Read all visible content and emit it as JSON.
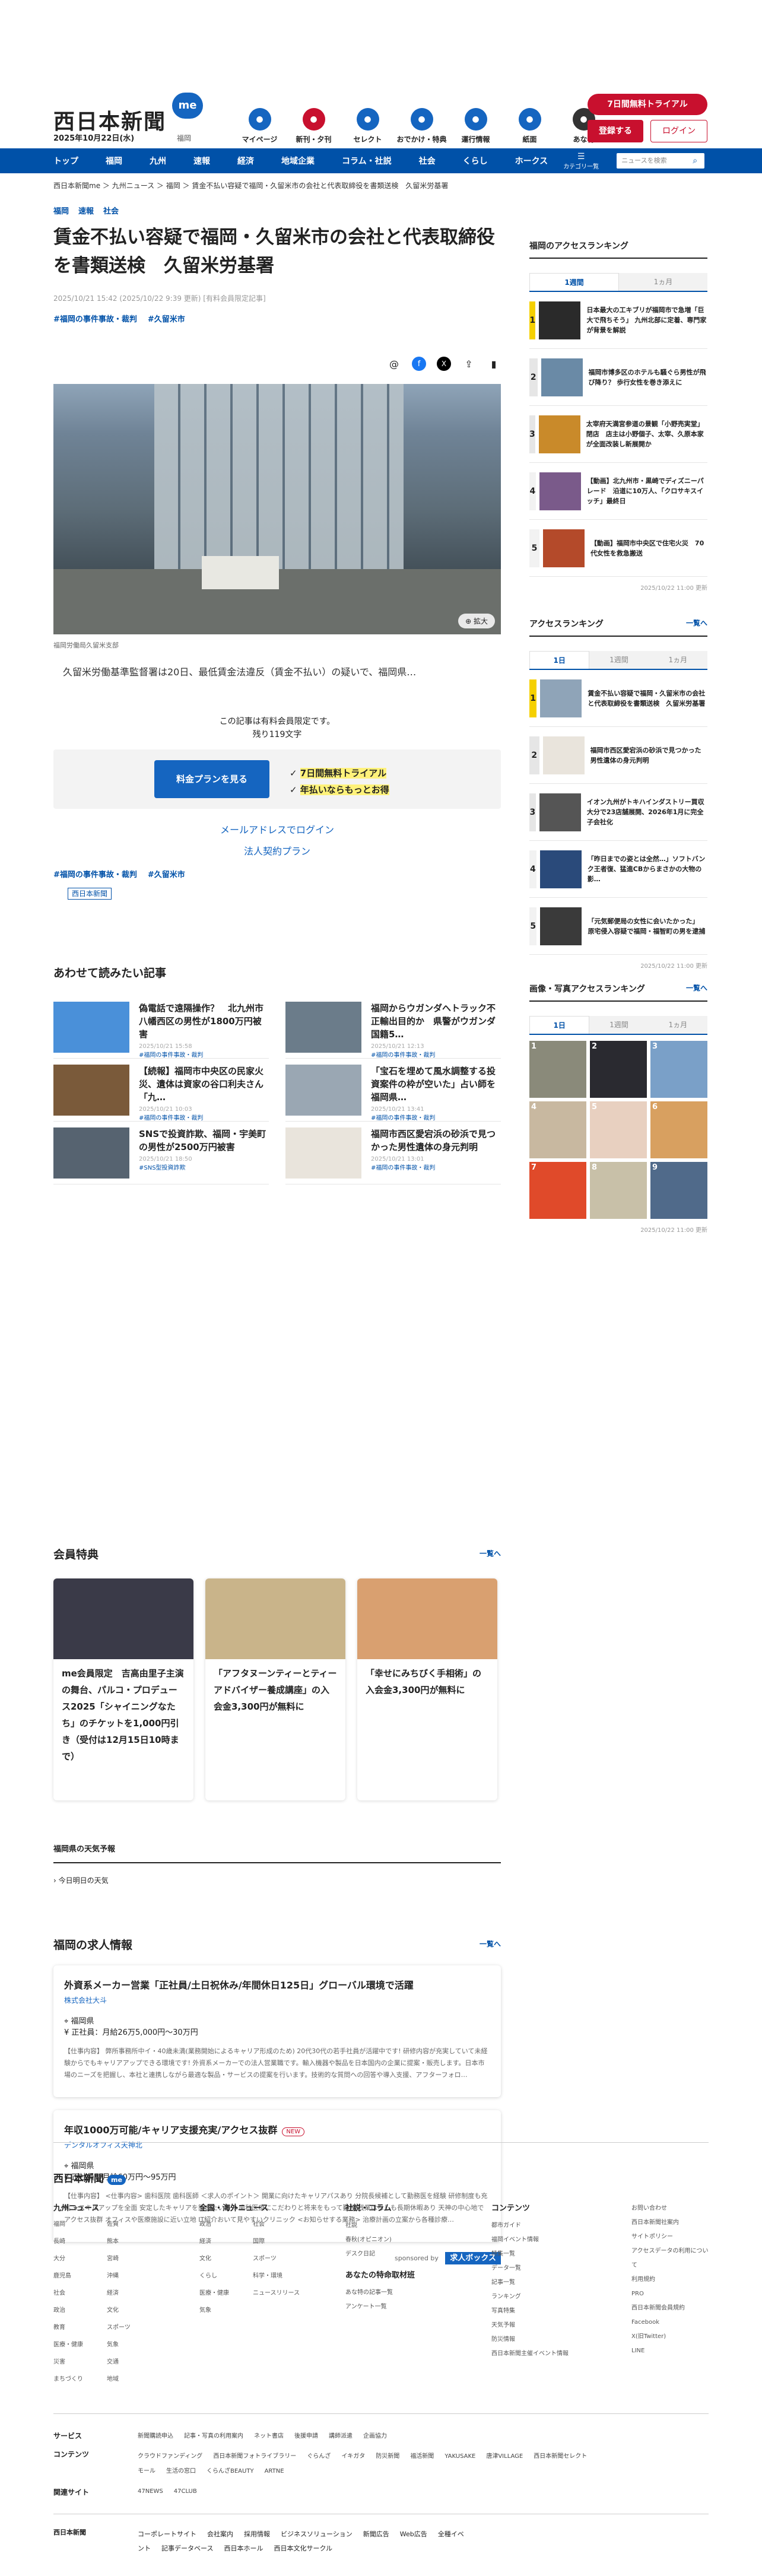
{
  "header": {
    "logo": "西日本新聞",
    "logo_badge": "me",
    "date": "2025年10月22日(水)",
    "area": "福岡",
    "nav": [
      {
        "label": "マイページ",
        "icon": "me-icon",
        "color": "#1565c0"
      },
      {
        "label": "新刊・夕刊",
        "icon": "newspaper-icon",
        "color": "#c8102e"
      },
      {
        "label": "セレクト",
        "icon": "select-icon",
        "color": "#1565c0"
      },
      {
        "label": "おでかけ・特典",
        "icon": "walk-icon",
        "color": "#1565c0"
      },
      {
        "label": "運行情報",
        "icon": "train-icon",
        "color": "#1565c0"
      },
      {
        "label": "紙面",
        "icon": "paper-icon",
        "color": "#1565c0"
      },
      {
        "label": "あな特",
        "icon": "anatoku-icon",
        "color": "#333333"
      }
    ],
    "trial": "7日間無料トライアル",
    "register": "登録する",
    "login": "ログイン"
  },
  "gnav": {
    "items": [
      "トップ",
      "福岡",
      "九州",
      "速報",
      "経済",
      "地域企業",
      "コラム・社説",
      "社会",
      "くらし",
      "ホークス"
    ],
    "category": "カテゴリ一覧",
    "search_placeholder": "ニュースを検索"
  },
  "breadcrumb": "西日本新聞me ＞ 九州ニュース ＞ 福岡 ＞ 賃金不払い容疑で福岡・久留米市の会社と代表取締役を書類送検　久留米労基署",
  "article": {
    "tags": [
      "福岡",
      "速報",
      "社会"
    ],
    "title": "賃金不払い容疑で福岡・久留米市の会社と代表取締役を書類送検　久留米労基署",
    "meta": "2025/10/21 15:42 (2025/10/22 9:39 更新) [有料会員限定記事]",
    "hashtags": [
      "#福岡の事件事故・裁判",
      "#久留米市"
    ],
    "photo_caption": "福岡労働局久留米支部",
    "zoom": "拡大",
    "lead": "久留米労働基準監督署は20日、最低賃金法違反（賃金不払い）の疑いで、福岡県…",
    "paywall1": "この記事は有料会員限定です。",
    "paywall2": "残り119文字",
    "plan_button": "料金プランを見る",
    "note1": "7日間無料トライアル",
    "note2": "年払いならもっとお得",
    "email_login": "メールアドレスでログイン",
    "corp_plan": "法人契約プラン",
    "publisher": "西日本新聞"
  },
  "related": {
    "title": "あわせて読みたい記事",
    "items": [
      {
        "title": "偽電話で遠隔操作？　北九州市八幡西区の男性が1800万円被害",
        "date": "2025/10/21 15:58",
        "tag": "#福岡の事件事故・裁判",
        "color": "#4a90d9"
      },
      {
        "title": "福岡からウガンダへトラック不正輸出目的か　県警がウガンダ国籍5…",
        "date": "2025/10/21 12:13",
        "tag": "#福岡の事件事故・裁判",
        "color": "#6b7c8a"
      },
      {
        "title": "【続報】福岡市中央区の民家火災、遺体は資家の谷口利夫さん「九…",
        "date": "2025/10/21 10:03",
        "tag": "#福岡の事件事故・裁判",
        "color": "#7a5a3a"
      },
      {
        "title": "「宝石を埋めて風水調整する投資案件の枠が空いた」占い師を福岡県…",
        "date": "2025/10/21 13:41",
        "tag": "#福岡の事件事故・裁判",
        "color": "#9aa7b3"
      },
      {
        "title": "SNSで投資詐欺、福岡・宇美町の男性が2500万円被害",
        "date": "2025/10/21 18:50",
        "tag": "#SNS型投資詐欺",
        "color": "#566370"
      },
      {
        "title": "福岡市西区愛宕浜の砂浜で見つかった男性遺体の身元判明",
        "date": "2025/10/21 13:01",
        "tag": "#福岡の事件事故・裁判",
        "color": "#e9e4dc"
      }
    ]
  },
  "perks": {
    "title": "会員特典",
    "more": "一覧へ",
    "items": [
      {
        "title": "me会員限定　吉高由里子主演の舞台、パルコ・プロデュース2025「シャイニングなたち」のチケットを1,000円引き（受付は12月15日10時まで）",
        "color": "#3a3a48"
      },
      {
        "title": "「アフタヌーンティーとティーアドバイザー養成講座」の入会金3,300円が無料に",
        "color": "#c9b48a"
      },
      {
        "title": "「幸せにみちびく手相術」の入会金3,300円が無料に",
        "color": "#d9a070"
      }
    ]
  },
  "weather": {
    "title": "福岡県の天気予報",
    "link": "今日明日の天気"
  },
  "jobs": {
    "title": "福岡の求人情報",
    "more": "一覧へ",
    "items": [
      {
        "title": "外資系メーカー営業「正社員/土日祝休み/年間休日125日」グローバル環境で活躍",
        "company": "株式会社大斗",
        "area": "福岡県",
        "salary": "正社員：月給26万5,000円〜30万円",
        "desc": "【仕事内容】 弊所事務所中イ・40歳未満(業務開始によるキャリア形成のため) 20代30代の若手社員が活躍中です! 研修内容が充実していて未経験からでもキャリアアップできる環境です! 外資系メーカーでの法人営業職です。輸入機器や製品を日本国内の企業に提案・販売します。日本市場のニーズを把握し、本社と連携しながら最適な製品・サービスの提案を行います。技術的な質問への回答や導入支援、アフターフォロ…",
        "badge": ""
      },
      {
        "title": "年収1000万可能/キャリア支援充実/アクセス抜群",
        "company": "デンタルオフィス天神北",
        "area": "福岡県",
        "salary": "正社員：月給60万円〜95万円",
        "desc": "【仕事内容】 <仕事内容> 歯科医院 歯科医師 ＜求人のポイント＞ 開業に向けたキャリアパスあり 分院長候補として勤務医を経験 研修制度も充実 ★スキルアップを全面 安定したキャリアを築きたい方 ★歯科医療にこだわりと将来をもって勤務 残業はなしも長期休暇あり 天神の中心地でアクセス抜群 オフィスや医療施設に近い立地 IT紹介おいて見やすいクリニック <お知らせする業務> 治療計画の立案から各種診療…",
        "badge": "NEW"
      }
    ],
    "sponsored": "sponsored by",
    "sponsor_name": "求人ボックス"
  },
  "side": {
    "access": {
      "title": "福岡のアクセスランキング",
      "tabs": [
        "1週間",
        "1ヵ月"
      ],
      "items": [
        {
          "no": "1",
          "title": "日本最大の工キブリが福岡市で急増「巨大で飛ちそう」 九州北部に定着、専門家が背景を解説",
          "color": "#2a2a2a"
        },
        {
          "no": "2",
          "title": "福岡市博多区のホテルも騒ぐら男性が飛び降り？ 歩行女性を巻き添えに",
          "color": "#6a8aa6"
        },
        {
          "no": "3",
          "title": "太宰府天満宮参道の景観「小野売実堂」閉店　店主は小野個子、太宰、久原本家が全面改装し新展開か",
          "color": "#c98a2a"
        },
        {
          "no": "4",
          "title": "【動画】北九州市・黒崎でディズニーパレード　沿道に10万人、「クロサキスイッチ」最終日",
          "color": "#7a5a8a"
        },
        {
          "no": "5",
          "title": "【動画】福岡市中央区で住宅火災　70代女性を救急搬送",
          "color": "#b44a2a"
        }
      ],
      "updated": "2025/10/22 11:00 更新"
    },
    "all": {
      "title": "アクセスランキング",
      "more": "一覧へ",
      "tabs": [
        "1日",
        "1週間",
        "1ヵ月"
      ],
      "items": [
        {
          "no": "1",
          "title": "賃金不払い容疑で福岡・久留米市の会社と代表取締役を書類送検　久留米労基署",
          "color": "#8fa4b8"
        },
        {
          "no": "2",
          "title": "福岡市西区愛宕浜の砂浜で見つかった男性遺体の身元判明",
          "color": "#e9e4dc"
        },
        {
          "no": "3",
          "title": "イオン九州がトキハインダストリー買収　大分で23店舗展開、2026年1月に完全子会社化",
          "color": "#555555"
        },
        {
          "no": "4",
          "title": "「昨日までの姿とは全然…」ソフトバンク王者復、猛進CBからまさかの大物の影…",
          "color": "#2a4a7a"
        },
        {
          "no": "5",
          "title": "「元気郵便局の女性に会いたかった」 原宅侵入容疑で福岡・福智町の男を逮捕",
          "color": "#3a3a3a"
        }
      ],
      "updated": "2025/10/22 11:00 更新"
    },
    "images": {
      "title": "画像・写真アクセスランキング",
      "more": "一覧へ",
      "tabs": [
        "1日",
        "1週間",
        "1ヵ月"
      ],
      "items": [
        {
          "no": "1",
          "color": "#8a8a7a"
        },
        {
          "no": "2",
          "color": "#2a2a30"
        },
        {
          "no": "3",
          "color": "#7aa0c8"
        },
        {
          "no": "4",
          "color": "#c8b8a0"
        },
        {
          "no": "5",
          "color": "#e8d0c0"
        },
        {
          "no": "6",
          "color": "#d8a060"
        },
        {
          "no": "7",
          "color": "#e04a2a"
        },
        {
          "no": "8",
          "color": "#c8c0a8"
        },
        {
          "no": "9",
          "color": "#506a8a"
        }
      ],
      "updated": "2025/10/22 11:00 更新"
    }
  },
  "footer": {
    "logo": "西日本新聞",
    "logo_badge": "me",
    "cols": [
      {
        "title": "九州ニュース",
        "items": [
          "福岡",
          "佐賀",
          "長崎",
          "熊本",
          "大分",
          "宮崎",
          "鹿児島",
          "沖縄",
          "社会",
          "経済",
          "政治",
          "文化",
          "教育",
          "スポーツ",
          "医療・健康",
          "気象",
          "災害",
          "交通",
          "まちづくり",
          "地域"
        ]
      },
      {
        "title": "全国・海外ニュース",
        "items": [
          "政治",
          "社会",
          "経済",
          "国際",
          "文化",
          "スポーツ",
          "くらし",
          "科学・環境",
          "医療・健康",
          "ニュースリリース",
          "気象"
        ]
      },
      {
        "title": "社説・コラム",
        "items": [
          "社説",
          "春秋(オピニオン)",
          "デスク日記"
        ]
      }
    ],
    "col3_sub": "あなたの特命取材班",
    "col3_sub_items": [
      "あな特の記事一覧",
      "アンケート一覧"
    ],
    "contents_title": "コンテンツ",
    "contents": [
      "都市ガイド",
      "福岡イベント情報",
      "特集一覧",
      "データ一覧",
      "記事一覧",
      "ランキング",
      "写真特集",
      "天気予報",
      "防災情報",
      "西日本新聞主催イベント情報"
    ],
    "links": [
      "お問い合わせ",
      "西日本新聞社案内",
      "サイトポリシー",
      "アクセスデータの利用について",
      "利用規約",
      "PRO",
      "西日本新聞会員規約",
      "Facebook",
      "X(旧Twitter)",
      "LINE"
    ],
    "service_label": "サービス",
    "service": [
      "新聞購読申込",
      "記事・写真の利用案内",
      "ネット書店",
      "後援申請",
      "講師派遣",
      "企画協力"
    ],
    "contents2_label": "コンテンツ",
    "contents2": [
      "クラウドファンディング",
      "西日本新聞フォトライブラリー",
      "ぐらんざ",
      "イキガタ",
      "防災新聞",
      "福活新聞",
      "YAKUSAKE",
      "唐津VILLAGE",
      "西日本新聞セレクトモール",
      "生活の窓口",
      "くらんざBEAUTY",
      "ARTNE"
    ],
    "related_label": "関連サイト",
    "related": [
      "47NEWS",
      "47CLUB"
    ],
    "bottom_logo": "西日本新聞",
    "bottom": [
      "コーポレートサイト",
      "会社案内",
      "採用情報",
      "ビジネスソリューション",
      "新聞広告",
      "Web広告",
      "全種イベント",
      "記事データベース",
      "西日本ホール",
      "西日本文化サークル"
    ]
  }
}
